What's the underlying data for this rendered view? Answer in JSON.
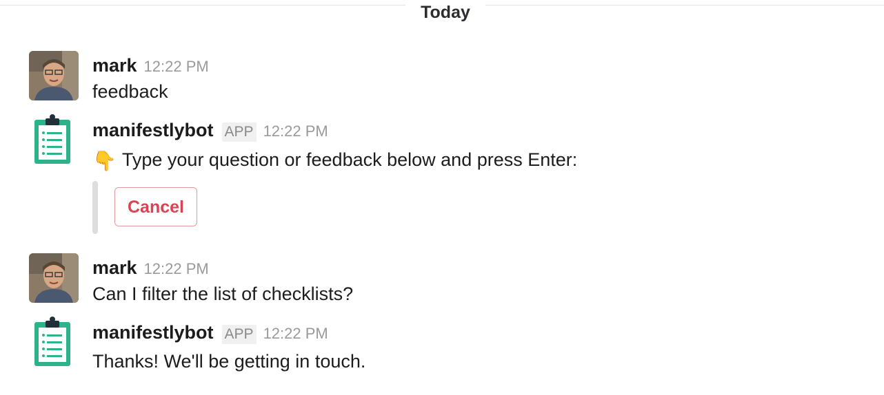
{
  "day_divider": {
    "label": "Today"
  },
  "messages": [
    {
      "sender": "mark",
      "time": "12:22 PM",
      "text": "feedback"
    },
    {
      "sender": "manifestlybot",
      "badge": "APP",
      "time": "12:22 PM",
      "emoji": "👇",
      "text": "Type your question or feedback below and press Enter:",
      "attachment": {
        "cancel_label": "Cancel"
      }
    },
    {
      "sender": "mark",
      "time": "12:22 PM",
      "text": "Can I filter the list of checklists?"
    },
    {
      "sender": "manifestlybot",
      "badge": "APP",
      "time": "12:22 PM",
      "text": "Thanks! We'll be getting in touch."
    }
  ],
  "colors": {
    "cancel": "#d94452",
    "bot_icon": "#2db38a"
  },
  "icons": {
    "bot_avatar": "clipboard-icon",
    "user_avatar": "user-photo"
  }
}
